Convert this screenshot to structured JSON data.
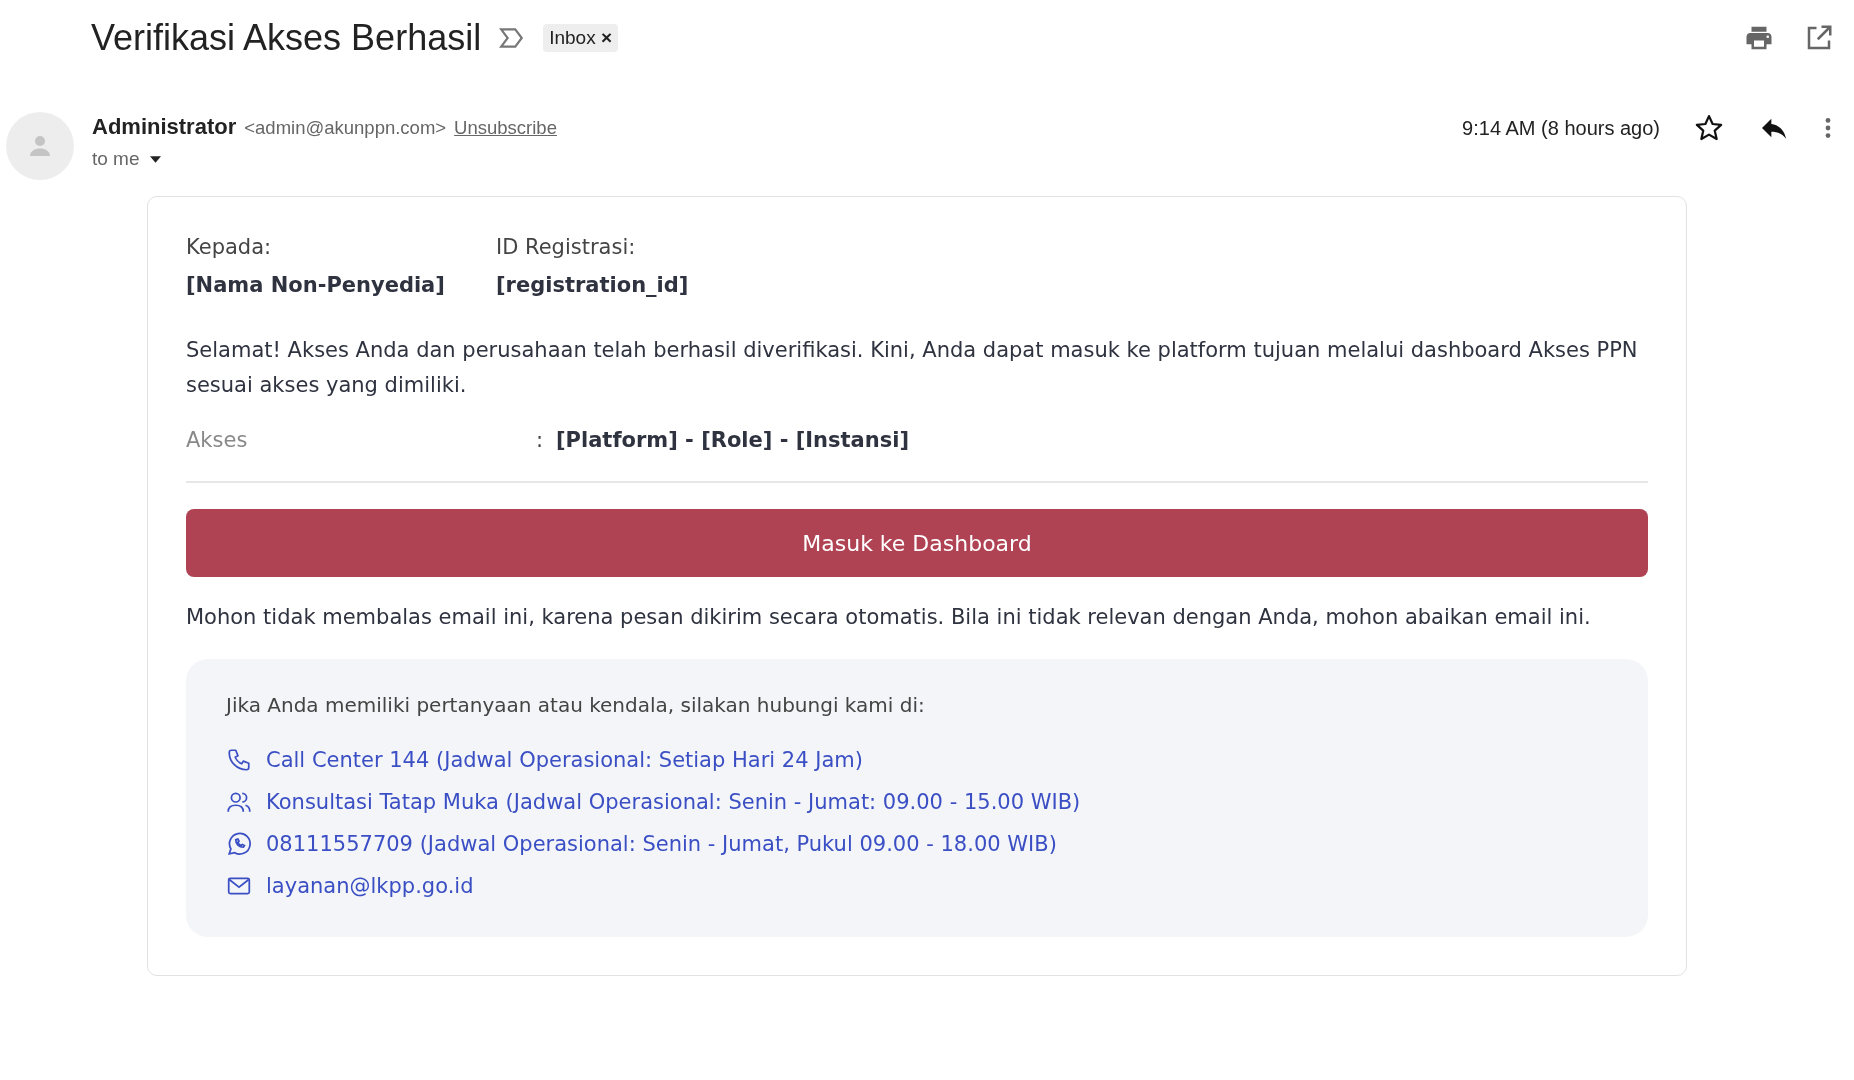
{
  "subject": "Verifikasi Akses Berhasil",
  "label": {
    "text": "Inbox",
    "remove": "×"
  },
  "sender": {
    "name": "Administrator",
    "email": "<admin@akunppn.com>",
    "unsubscribe": "Unsubscribe",
    "recipient": "to me",
    "time": "9:14 AM (8 hours ago)"
  },
  "body": {
    "fields": [
      {
        "label": "Kepada:",
        "value": "[Nama Non-Penyedia]"
      },
      {
        "label": "ID Registrasi:",
        "value": "[registration_id]"
      }
    ],
    "message": "Selamat! Akses Anda dan perusahaan telah berhasil diverifikasi. Kini, Anda dapat masuk ke platform tujuan melalui dashboard Akses PPN sesuai akses yang dimiliki.",
    "access": {
      "label": "Akses",
      "separator": ":",
      "value": "[Platform] - [Role] - [Instansi]"
    },
    "button": "Masuk ke Dashboard",
    "notice": "Mohon tidak membalas email ini, karena pesan dikirim secara otomatis. Bila ini tidak relevan dengan Anda, mohon abaikan email ini.",
    "contact": {
      "intro": "Jika Anda memiliki pertanyaan atau kendala, silakan hubungi kami di:",
      "items": [
        {
          "kind": "phone",
          "text": "Call Center 144 (Jadwal Operasional: Setiap Hari 24 Jam)"
        },
        {
          "kind": "people",
          "text": "Konsultasi Tatap Muka (Jadwal Operasional: Senin - Jumat: 09.00 - 15.00 WIB)"
        },
        {
          "kind": "chat",
          "text": "08111557709 (Jadwal Operasional: Senin - Jumat, Pukul 09.00 - 18.00 WIB)"
        },
        {
          "kind": "mail",
          "text": "layanan@lkpp.go.id"
        }
      ]
    }
  }
}
